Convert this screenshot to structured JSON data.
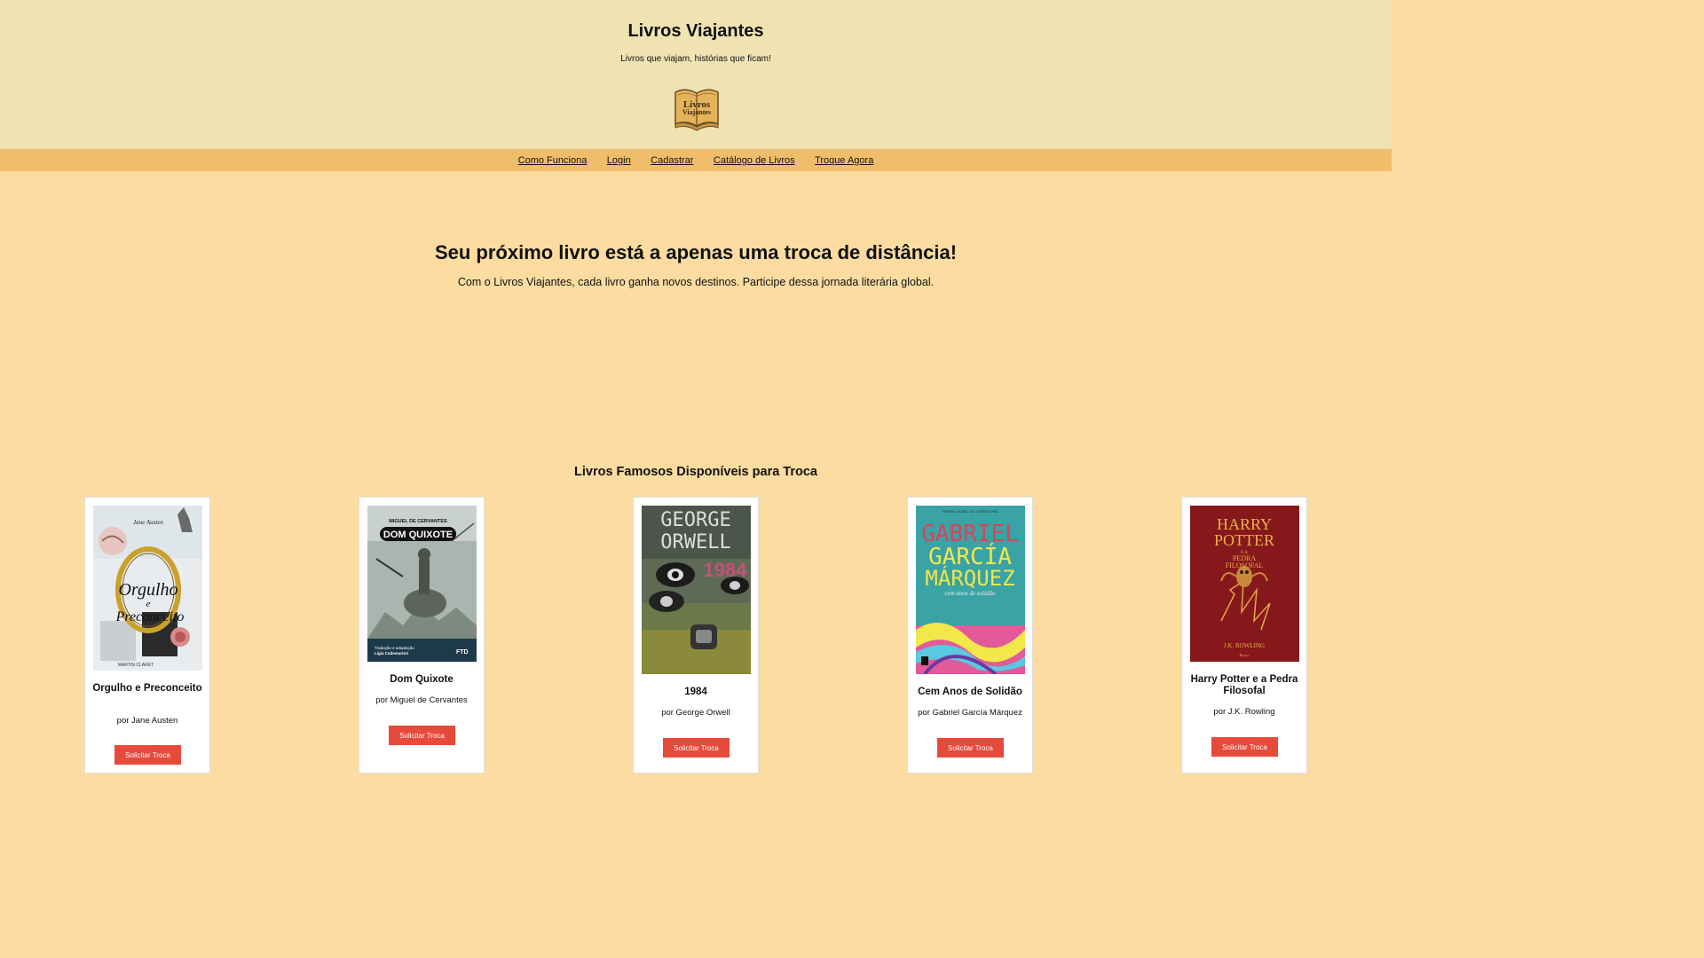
{
  "site": {
    "title": "Livros Viajantes",
    "tagline": "Livros que viajam, histórias que ficam!",
    "logo_text_1": "Livros",
    "logo_text_2": "Viajantes"
  },
  "nav": [
    "Como Funciona",
    "Login",
    "Cadastrar",
    "Catálogo de Livros",
    "Troque Agora"
  ],
  "hero": {
    "title": "Seu próximo livro está a apenas uma troca de distância!",
    "text": "Com o Livros Viajantes, cada livro ganha novos destinos. Participe dessa jornada literária global."
  },
  "catalog": {
    "title": "Livros Famosos Disponíveis para Troca",
    "button_label": "Solicitar Troca",
    "books": [
      {
        "title": "Orgulho e Preconceito",
        "author": "por Jane Austen",
        "cover_lines": [
          "Jane Austen",
          "Orgulho",
          "e",
          "Preconceito",
          "MARTIN CLARET"
        ]
      },
      {
        "title": "Dom Quixote",
        "author": "por Miguel de Cervantes",
        "cover_lines": [
          "MIGUEL DE CERVANTES",
          "DOM QUIXOTE",
          "Tradução e adaptação",
          "Ligia Cademartori",
          "FTD"
        ]
      },
      {
        "title": "1984",
        "author": "por George Orwell",
        "cover_lines": [
          "GEORGE",
          "ORWELL",
          "1984"
        ]
      },
      {
        "title": "Cem Anos de Solidão",
        "author": "por Gabriel García Márquez",
        "cover_lines": [
          "PRÊMIO NOBEL DE LITERATURA",
          "GABRIEL",
          "GARCÍA",
          "MÁRQUEZ",
          "cem anos de solidão"
        ]
      },
      {
        "title": "Harry Potter e a Pedra Filosofal",
        "author": "por J.K. Rowling",
        "cover_lines": [
          "HARRY",
          "POTTER",
          "E A",
          "PEDRA",
          "FILOSOFAL",
          "J.K. ROWLING",
          "Rocco"
        ]
      }
    ]
  },
  "colors": {
    "header_bg": "#efe3b2",
    "nav_bg": "#f0be6b",
    "page_bg": "#fcdca0",
    "button_bg": "#e64a3a"
  }
}
